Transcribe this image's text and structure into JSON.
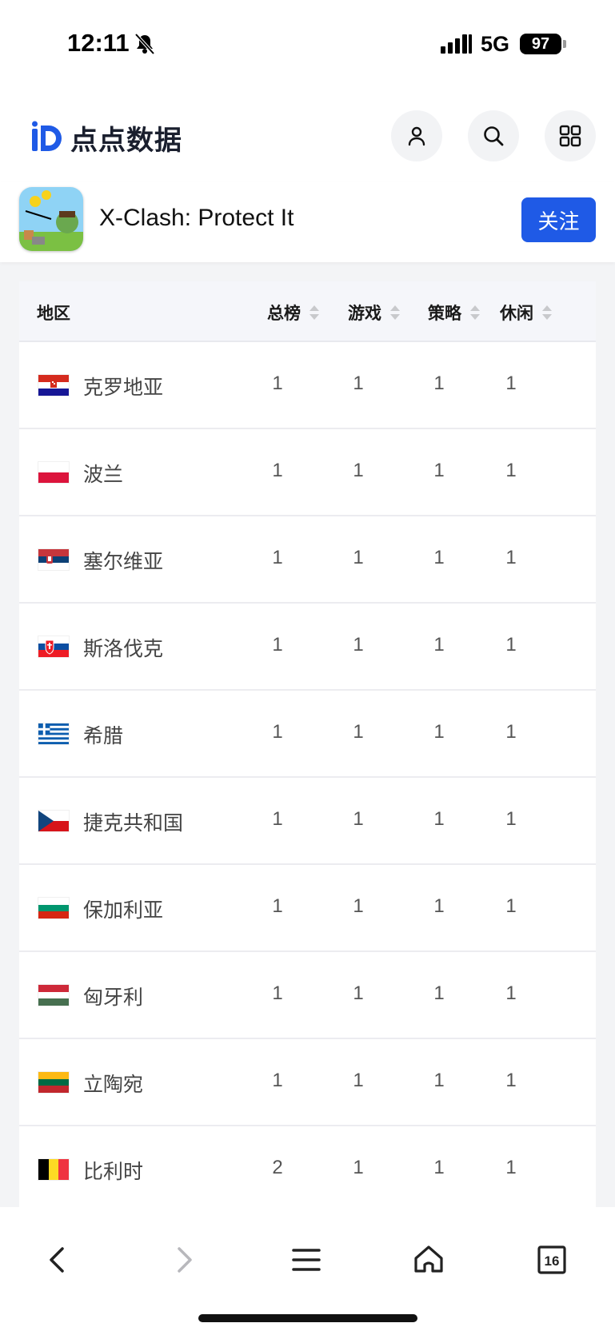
{
  "status_bar": {
    "time": "12:11",
    "network": "5G",
    "battery": "97"
  },
  "header": {
    "brand": "点点数据"
  },
  "app": {
    "name": "X-Clash: Protect It",
    "follow_label": "关注"
  },
  "table": {
    "columns": [
      "地区",
      "总榜",
      "游戏",
      "策略",
      "休闲"
    ],
    "rows": [
      {
        "flag": "croatia-flag",
        "country": "克罗地亚",
        "values": [
          "1",
          "1",
          "1",
          "1"
        ]
      },
      {
        "flag": "poland-flag",
        "country": "波兰",
        "values": [
          "1",
          "1",
          "1",
          "1"
        ]
      },
      {
        "flag": "serbia-flag",
        "country": "塞尔维亚",
        "values": [
          "1",
          "1",
          "1",
          "1"
        ]
      },
      {
        "flag": "slovakia-flag",
        "country": "斯洛伐克",
        "values": [
          "1",
          "1",
          "1",
          "1"
        ]
      },
      {
        "flag": "greece-flag",
        "country": "希腊",
        "values": [
          "1",
          "1",
          "1",
          "1"
        ]
      },
      {
        "flag": "czech-flag",
        "country": "捷克共和国",
        "values": [
          "1",
          "1",
          "1",
          "1"
        ]
      },
      {
        "flag": "bulgaria-flag",
        "country": "保加利亚",
        "values": [
          "1",
          "1",
          "1",
          "1"
        ]
      },
      {
        "flag": "hungary-flag",
        "country": "匈牙利",
        "values": [
          "1",
          "1",
          "1",
          "1"
        ]
      },
      {
        "flag": "lithuania-flag",
        "country": "立陶宛",
        "values": [
          "1",
          "1",
          "1",
          "1"
        ]
      },
      {
        "flag": "belgium-flag",
        "country": "比利时",
        "values": [
          "2",
          "1",
          "1",
          "1"
        ]
      }
    ]
  },
  "toolbar": {
    "tabs_count": "16"
  },
  "colors": {
    "accent": "#1f5ae6",
    "header_bg": "#f5f6fa"
  }
}
